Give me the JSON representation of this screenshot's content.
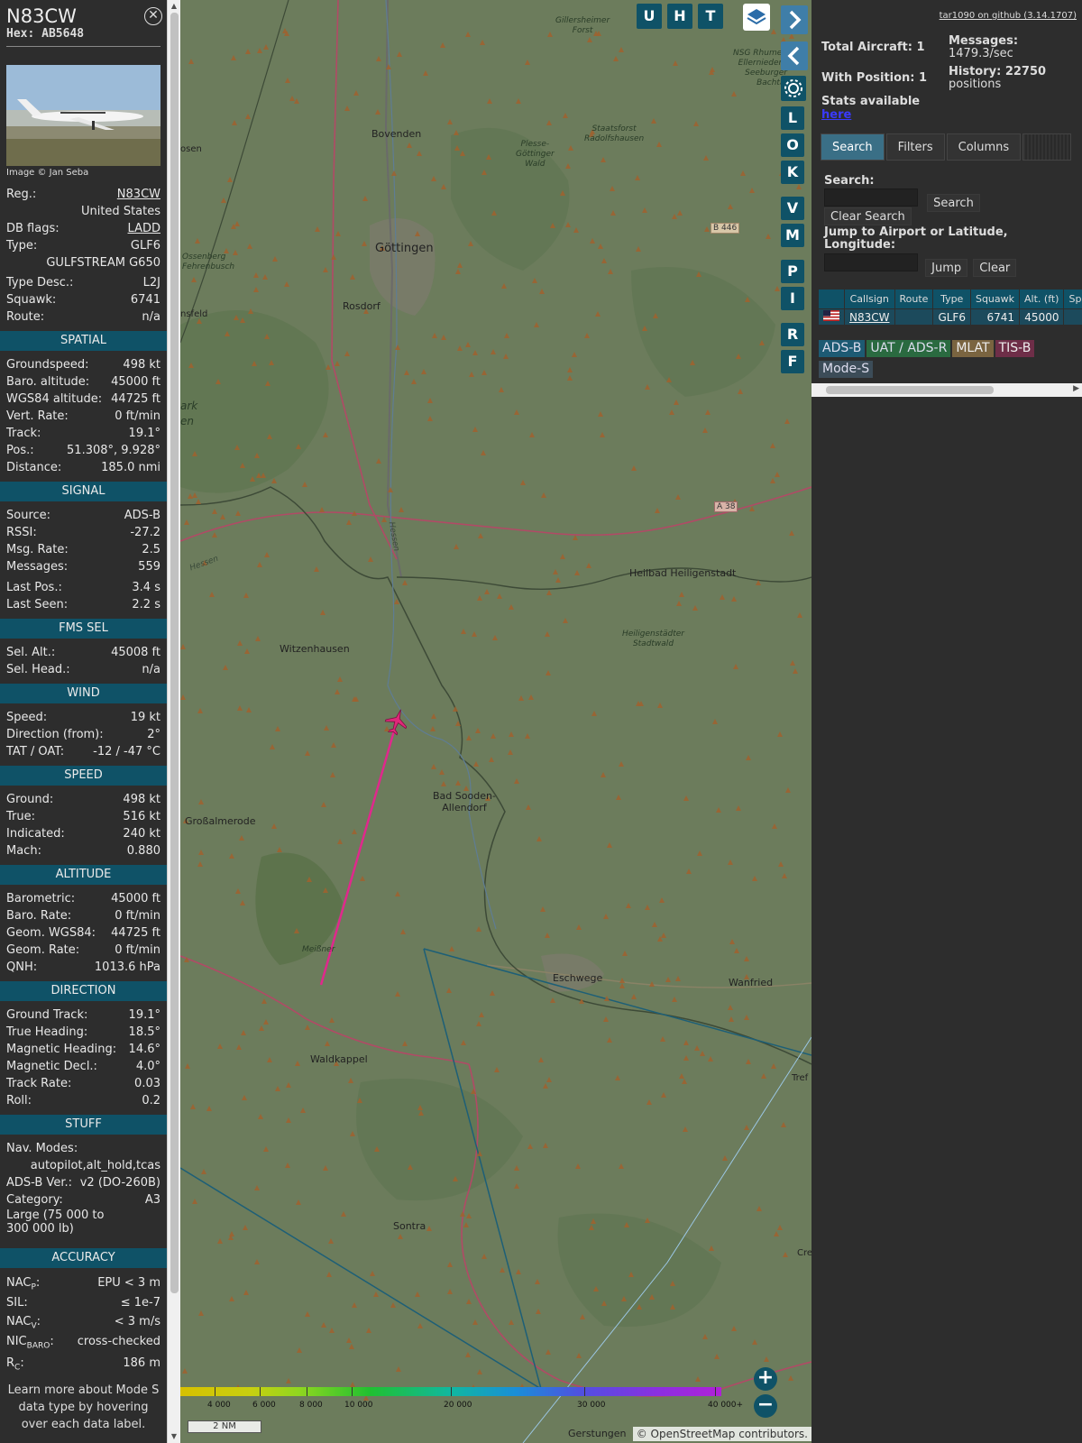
{
  "aircraft": {
    "callsign": "N83CW",
    "hex_label": "Hex: AB5648",
    "photo_credit": "Image © Jan Seba",
    "reg_label": "Reg.:",
    "reg_value": "N83CW",
    "country": "United States",
    "dbflags_label": "DB flags:",
    "dbflags_value": "LADD",
    "type_label": "Type:",
    "type_value": "GLF6",
    "type_full": "GULFSTREAM G650",
    "typedesc_label": "Type Desc.:",
    "typedesc_value": "L2J",
    "squawk_label": "Squawk:",
    "squawk_value": "6741",
    "route_label": "Route:",
    "route_value": "n/a"
  },
  "sections": {
    "spatial": {
      "title": "SPATIAL",
      "rows": [
        {
          "label": "Groundspeed:",
          "value": "498 kt"
        },
        {
          "label": "Baro. altitude:",
          "value": "45000 ft"
        },
        {
          "label": "WGS84 altitude:",
          "value": "44725 ft"
        },
        {
          "label": "Vert. Rate:",
          "value": "0 ft/min"
        },
        {
          "label": "Track:",
          "value": "19.1°"
        },
        {
          "label": "Pos.:",
          "value": "51.308°, 9.928°"
        },
        {
          "label": "Distance:",
          "value": "185.0 nmi"
        }
      ]
    },
    "signal": {
      "title": "SIGNAL",
      "rows": [
        {
          "label": "Source:",
          "value": "ADS-B"
        },
        {
          "label": "RSSI:",
          "value": "-27.2"
        },
        {
          "label": "Msg. Rate:",
          "value": "2.5"
        },
        {
          "label": "Messages:",
          "value": "559"
        }
      ],
      "rows2": [
        {
          "label": "Last Pos.:",
          "value": "3.4 s"
        },
        {
          "label": "Last Seen:",
          "value": "2.2 s"
        }
      ]
    },
    "fms": {
      "title": "FMS SEL",
      "rows": [
        {
          "label": "Sel. Alt.:",
          "value": "45008 ft"
        },
        {
          "label": "Sel. Head.:",
          "value": "n/a"
        }
      ]
    },
    "wind": {
      "title": "WIND",
      "rows": [
        {
          "label": "Speed:",
          "value": "19 kt"
        },
        {
          "label": "Direction (from):",
          "value": "2°"
        },
        {
          "label": "TAT / OAT:",
          "value": "-12 / -47 °C"
        }
      ]
    },
    "speed": {
      "title": "SPEED",
      "rows": [
        {
          "label": "Ground:",
          "value": "498 kt"
        },
        {
          "label": "True:",
          "value": "516 kt"
        },
        {
          "label": "Indicated:",
          "value": "240 kt"
        },
        {
          "label": "Mach:",
          "value": "0.880"
        }
      ]
    },
    "altitude": {
      "title": "ALTITUDE",
      "rows": [
        {
          "label": "Barometric:",
          "value": "45000 ft"
        },
        {
          "label": "Baro. Rate:",
          "value": "0 ft/min"
        },
        {
          "label": "Geom. WGS84:",
          "value": "44725 ft"
        },
        {
          "label": "Geom. Rate:",
          "value": "0 ft/min"
        },
        {
          "label": "QNH:",
          "value": "1013.6 hPa"
        }
      ]
    },
    "direction": {
      "title": "DIRECTION",
      "rows": [
        {
          "label": "Ground Track:",
          "value": "19.1°"
        },
        {
          "label": "True Heading:",
          "value": "18.5°"
        },
        {
          "label": "Magnetic Heading:",
          "value": "14.6°"
        },
        {
          "label": "Magnetic Decl.:",
          "value": "4.0°"
        },
        {
          "label": "Track Rate:",
          "value": "0.03"
        },
        {
          "label": "Roll:",
          "value": "0.2"
        }
      ]
    },
    "stuff": {
      "title": "STUFF",
      "navmodes_label": "Nav. Modes:",
      "navmodes_value": "autopilot,alt_hold,tcas",
      "adsbver_label": "ADS-B Ver.:",
      "adsbver_value": "v2 (DO-260B)",
      "category_label": "Category:",
      "category_value": "A3",
      "category_desc_1": "Large (75 000 to",
      "category_desc_2": "300 000 lb)"
    },
    "accuracy": {
      "title": "ACCURACY",
      "nacp_label": "NAC",
      "nacp_sub": "P",
      "nacp_value": "EPU < 3 m",
      "sil_label": "SIL:",
      "sil_value": "≤ 1e-7",
      "nacv_label": "NAC",
      "nacv_sub": "V",
      "nacv_value": "< 3 m/s",
      "nicbaro_label": "NIC",
      "nicbaro_sub": "BARO",
      "nicbaro_value": "cross-checked",
      "rc_label": "R",
      "rc_sub": "C",
      "rc_value": "186 m"
    },
    "learn_more": "Learn more about Mode S data type by hovering over each data label."
  },
  "map": {
    "buttons": [
      "U",
      "H",
      "T"
    ],
    "side_buttons": [
      "L",
      "O",
      "K",
      "V",
      "M",
      "P",
      "I",
      "R",
      "F"
    ],
    "places": {
      "bovenden": "Bovenden",
      "goettingen": "Göttingen",
      "rosdorf": "Rosdorf",
      "witzenhausen": "Witzenhausen",
      "heilbad": "Heilbad Heiligenstadt",
      "badsooden1": "Bad Sooden-",
      "badsooden2": "Allendorf",
      "grossalmerode": "Großalmerode",
      "eschwege": "Eschwege",
      "wanfried": "Wanfried",
      "waldkappel": "Waldkappel",
      "sontra": "Sontra",
      "gerstungen": "Gerstungen",
      "plesse1": "Plesse-",
      "plesse2": "Göttinger",
      "plesse3": "Wald",
      "staatsforst1": "Staatsforst",
      "staatsforst2": "Radolfshausen",
      "gillersheimer1": "Gillersheimer",
      "gillersheimer2": "Forst",
      "heiligenstaedter1": "Heiligenstädter",
      "heiligenstaedter2": "Stadtwald",
      "meissner": "Meißner",
      "hessen1": "Hessen",
      "hessen2": "Hessen",
      "ossenberg1": "Ossenberg",
      "ossenberg2": "Fehrenbusch",
      "nsg1": "NSG Rhumeq",
      "nsg2": "Ellerniederu",
      "nsg3": "Seeburger",
      "nsg4": "Bachtal",
      "sen": "osen",
      "sfeld": "nsfeld",
      "ark1": "ark",
      "ark2": "en",
      "tref": "Tref",
      "cre": "Cre"
    },
    "road_labels": [
      "B 446",
      "A 38"
    ],
    "scale_label": "2 NM",
    "attribution": "© OpenStreetMap contributors.",
    "altitude_legend": [
      "4 000",
      "6 000",
      "8 000",
      "10 000",
      "20 000",
      "30 000",
      "40 000+"
    ]
  },
  "stats": {
    "version_link": "tar1090 on github (3.14.1707)",
    "total_aircraft": "Total Aircraft: 1",
    "with_position": "With Position: 1",
    "stats_available": "Stats available",
    "here": "here",
    "messages_label": "Messages:",
    "messages_value": "1479.3/sec",
    "history_label": "History: 22750",
    "history_value": "positions"
  },
  "tabs": {
    "search": "Search",
    "filters": "Filters",
    "columns": "Columns"
  },
  "search": {
    "label": "Search:",
    "search_btn": "Search",
    "clear_btn": "Clear Search",
    "jump_label": "Jump to Airport or Latitude, Longitude:",
    "jump_btn": "Jump",
    "jump_clear_btn": "Clear"
  },
  "table": {
    "headers": [
      "Callsign",
      "Route",
      "Type",
      "Squawk",
      "Alt. (ft)",
      "Spd."
    ],
    "row": {
      "callsign": "N83CW",
      "route": "",
      "type": "GLF6",
      "squawk": "6741",
      "alt": "45000"
    }
  },
  "source_tags": [
    "ADS-B",
    "UAT / ADS-R",
    "MLAT",
    "TIS-B",
    "Mode-S"
  ],
  "colors": {
    "accent": "#0f5267",
    "track": "#e0288c",
    "aircraft": "#e0287a"
  }
}
